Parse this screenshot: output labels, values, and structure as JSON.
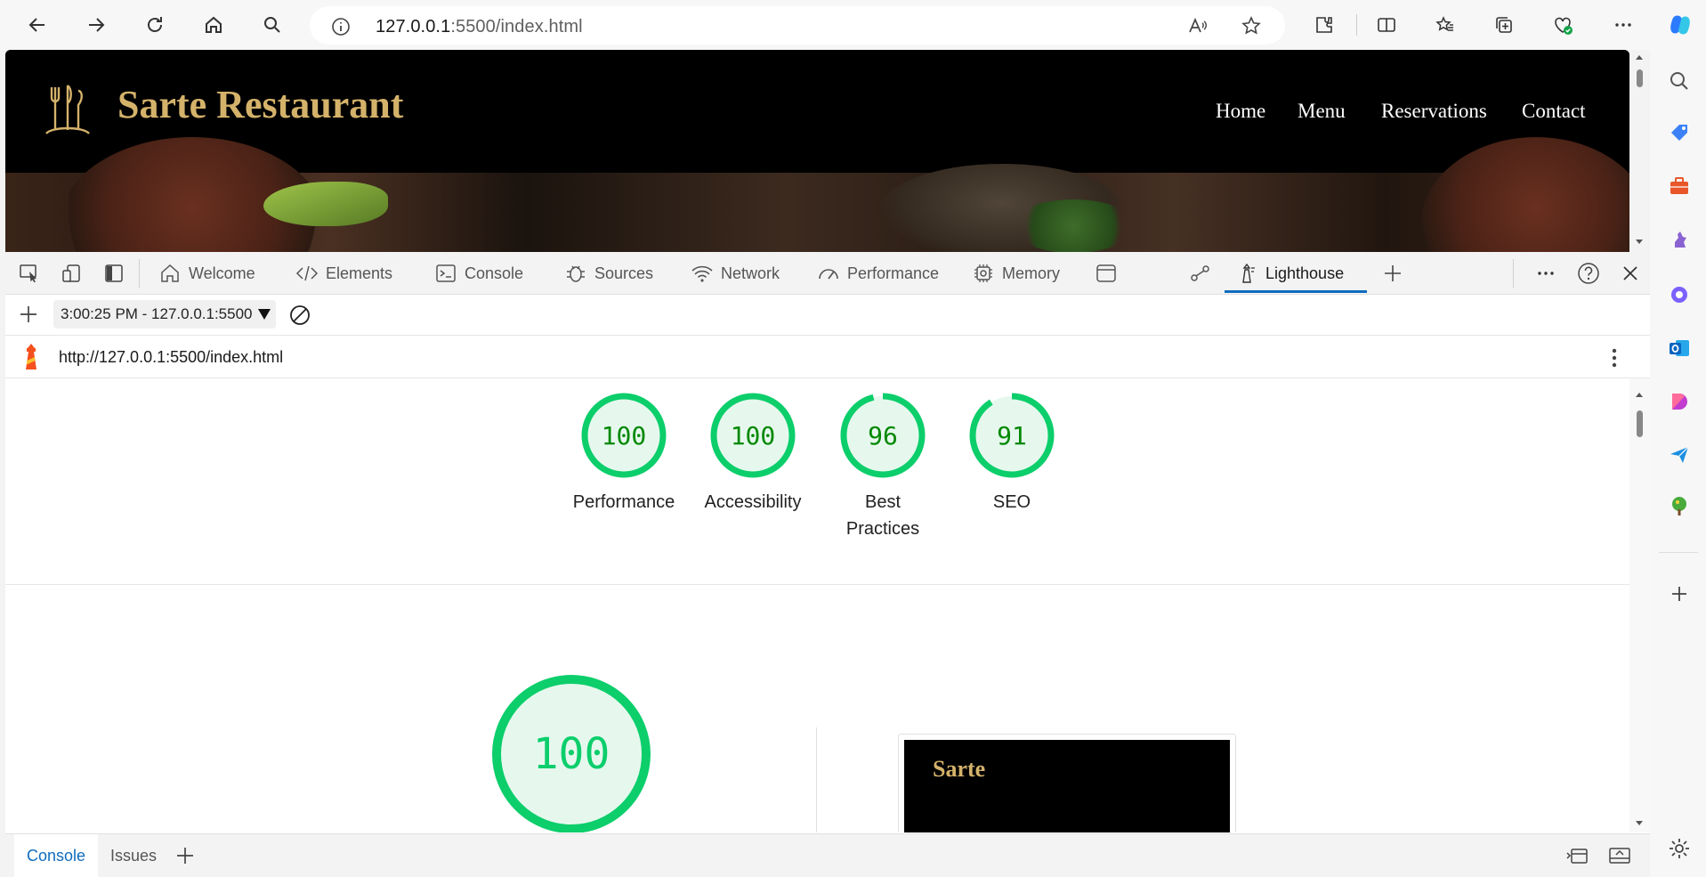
{
  "browser": {
    "url_host": "127.0.0.1",
    "url_rest": ":5500/index.html",
    "icons": [
      "back-icon",
      "forward-icon",
      "refresh-icon",
      "home-icon",
      "search-icon",
      "info-icon",
      "read-aloud-icon",
      "favorite-star-icon",
      "extensions-icon",
      "split-screen-icon",
      "favorites-icon",
      "collections-icon",
      "browser-essentials-icon",
      "more-icon",
      "copilot-icon"
    ]
  },
  "site": {
    "title": "Sarte Restaurant",
    "nav": [
      "Home",
      "Menu",
      "Reservations",
      "Contact"
    ],
    "gold": "#d4b26a"
  },
  "devtools": {
    "tabs": [
      "Welcome",
      "Elements",
      "Console",
      "Sources",
      "Network",
      "Performance",
      "Memory",
      "Lighthouse"
    ],
    "active_tab": "Lighthouse",
    "report_select": "3:00:25 PM - 127.0.0.1:5500",
    "report_url": "http://127.0.0.1:5500/index.html",
    "drawer_tabs": [
      "Console",
      "Issues"
    ]
  },
  "lighthouse": {
    "scores": [
      {
        "value": "100",
        "label": "Performance",
        "fraction": 1.0
      },
      {
        "value": "100",
        "label": "Accessibility",
        "fraction": 1.0
      },
      {
        "value": "96",
        "label": "Best Practices",
        "fraction": 0.96
      },
      {
        "value": "91",
        "label": "SEO",
        "fraction": 0.91
      }
    ],
    "big_score": "100",
    "thumb_title": "Sarte",
    "pass_color": "#0cce6b",
    "pass_text_color": "#008800"
  }
}
